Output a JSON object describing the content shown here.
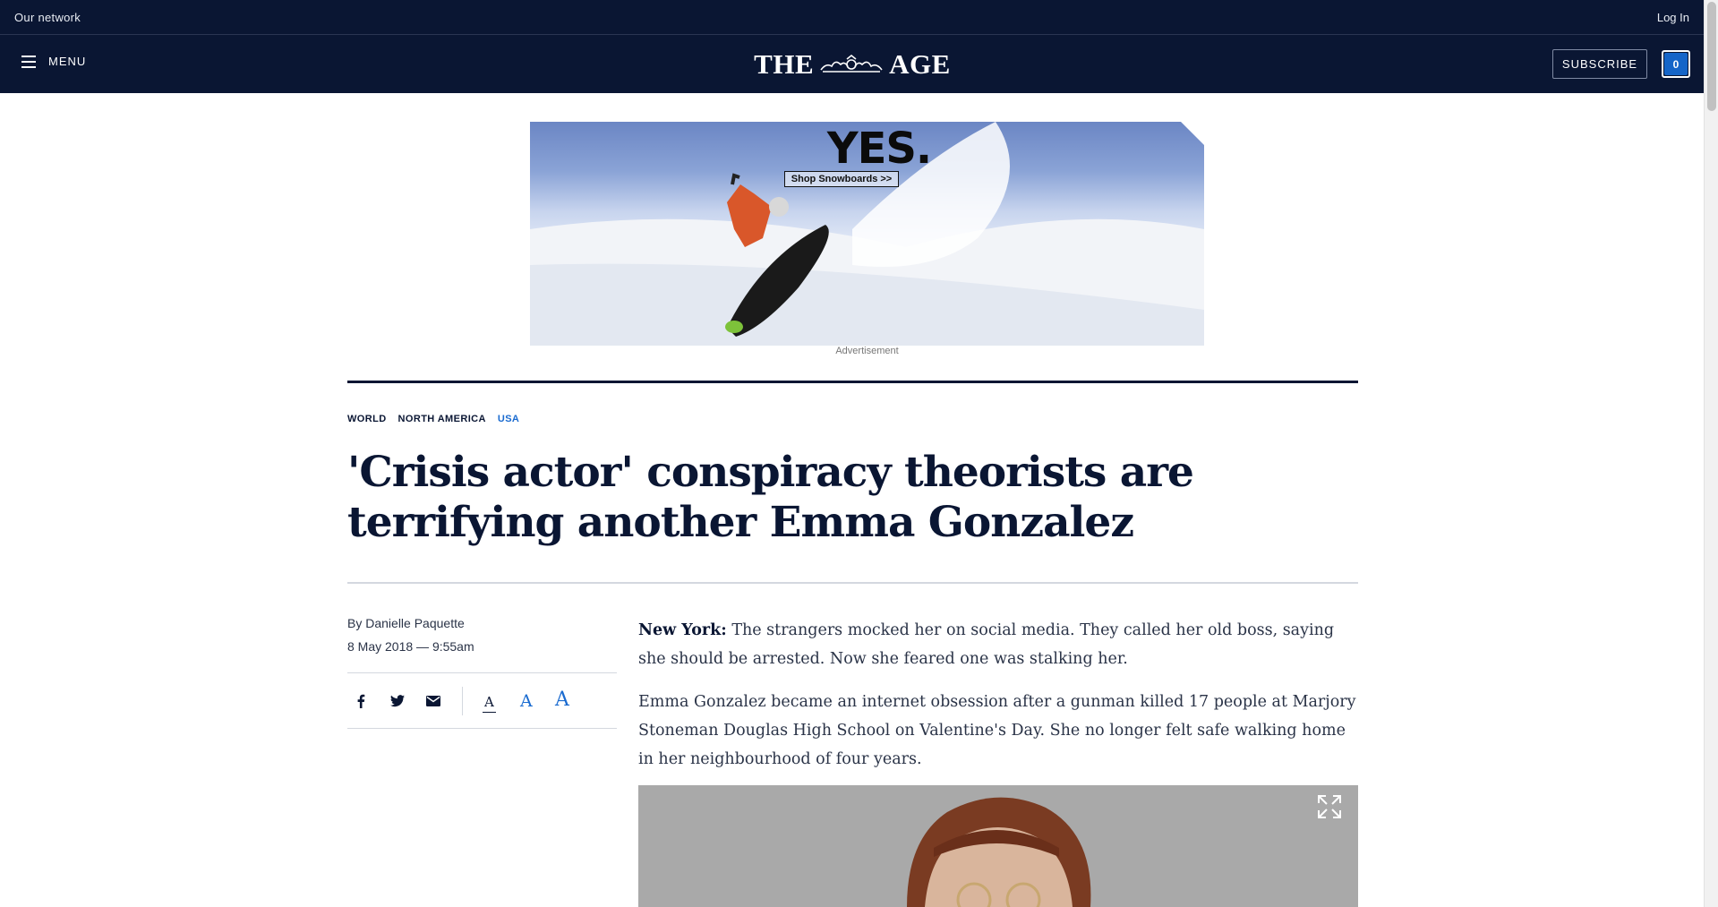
{
  "topbar": {
    "network": "Our network",
    "login": "Log In"
  },
  "header": {
    "menu_label": "MENU",
    "masthead_left": "THE",
    "masthead_right": "AGE",
    "subscribe": "SUBSCRIBE",
    "counter": "0"
  },
  "ad": {
    "headline": "YES.",
    "cta": "Shop Snowboards >>",
    "caption": "Advertisement"
  },
  "article": {
    "breadcrumb": [
      {
        "label": "WORLD",
        "active": false
      },
      {
        "label": "NORTH AMERICA",
        "active": false
      },
      {
        "label": "USA",
        "active": true
      }
    ],
    "headline": "'Crisis actor' conspiracy theorists are terrifying another Emma Gonzalez",
    "byline_prefix": "By ",
    "author": "Danielle Paquette",
    "date": "8 May 2018 — 9:55am",
    "share": {
      "facebook_icon": "facebook-icon",
      "twitter_icon": "twitter-icon",
      "email_icon": "email-icon",
      "font_small": "A",
      "font_medium": "A",
      "font_large": "A"
    },
    "paragraphs": [
      {
        "dateline": "New York:",
        "text": " The strangers mocked her on social media. They called her old boss, saying she should be arrested. Now she feared one was stalking her."
      },
      {
        "dateline": "",
        "text": "Emma Gonzalez became an internet obsession after a gunman killed 17 people at Marjory Stoneman Douglas High School on Valentine's Day. She no longer felt safe walking home in her neighbourhood of four years."
      }
    ]
  },
  "colors": {
    "navy": "#0a1633",
    "link_blue": "#1a6bd0",
    "counter_blue": "#1565c8"
  }
}
